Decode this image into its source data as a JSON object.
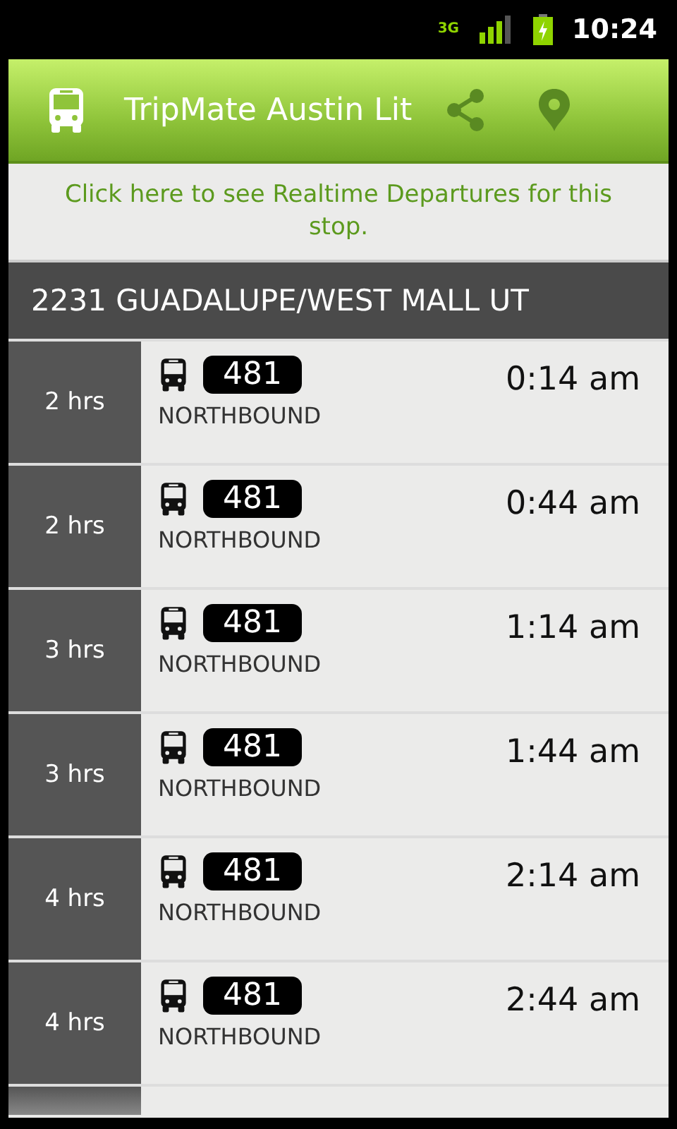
{
  "status_bar": {
    "network": "3G",
    "time": "10:24"
  },
  "app_bar": {
    "title": "TripMate Austin Lit"
  },
  "banner": {
    "text": "Click here to see Realtime Departures for this stop."
  },
  "stop": {
    "name": "2231 GUADALUPE/WEST MALL UT"
  },
  "departures": [
    {
      "wait": "2 hrs",
      "route": "481",
      "direction": "NORTHBOUND",
      "time": "0:14 am"
    },
    {
      "wait": "2 hrs",
      "route": "481",
      "direction": "NORTHBOUND",
      "time": "0:44 am"
    },
    {
      "wait": "3 hrs",
      "route": "481",
      "direction": "NORTHBOUND",
      "time": "1:14 am"
    },
    {
      "wait": "3 hrs",
      "route": "481",
      "direction": "NORTHBOUND",
      "time": "1:44 am"
    },
    {
      "wait": "4 hrs",
      "route": "481",
      "direction": "NORTHBOUND",
      "time": "2:14 am"
    },
    {
      "wait": "4 hrs",
      "route": "481",
      "direction": "NORTHBOUND",
      "time": "2:44 am"
    }
  ]
}
